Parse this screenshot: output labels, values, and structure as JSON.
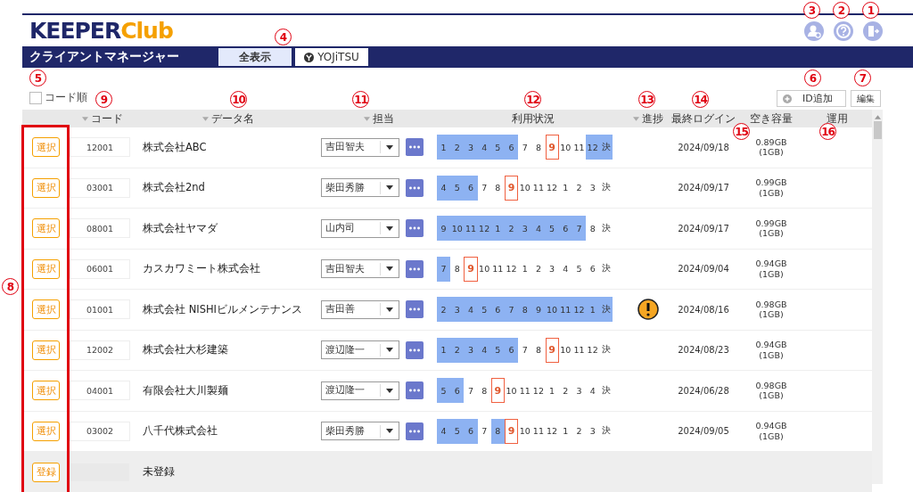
{
  "logo": {
    "brand": "KEEPER",
    "suffix": "Club"
  },
  "nav": {
    "title": "クライアントマネージャー",
    "tabs": [
      {
        "label": "全表示",
        "selected": true,
        "kind": "plain"
      },
      {
        "label": "YOJiTSU",
        "selected": false,
        "kind": "brand"
      }
    ]
  },
  "sort_option": {
    "label": "コード順",
    "checked": false
  },
  "toolbar": {
    "add_button": "ID追加",
    "edit_button": "編集"
  },
  "table": {
    "columns": [
      {
        "label": "コード",
        "sortable": true
      },
      {
        "label": "データ名",
        "sortable": true
      },
      {
        "label": "担当",
        "sortable": true
      },
      {
        "label": "利用状況",
        "sortable": false
      },
      {
        "label": "進捗",
        "sortable": true
      },
      {
        "label": "最終ログイン",
        "sortable": false
      },
      {
        "label": "空き容量",
        "sortable": false
      },
      {
        "label": "運用",
        "sortable": false
      }
    ],
    "rows": [
      {
        "kind": "client",
        "action": "選択",
        "code": "12001",
        "name": "株式会社ABC",
        "staff": "吉田智夫",
        "warning": false,
        "last_login": "2024/09/18",
        "capacity": "0.89GB",
        "quota": "(1GB)",
        "months": [
          {
            "m": "1",
            "used": true,
            "current": false
          },
          {
            "m": "2",
            "used": true,
            "current": false
          },
          {
            "m": "3",
            "used": true,
            "current": false
          },
          {
            "m": "4",
            "used": true,
            "current": false
          },
          {
            "m": "5",
            "used": true,
            "current": false
          },
          {
            "m": "6",
            "used": true,
            "current": false
          },
          {
            "m": "7",
            "used": false,
            "current": false
          },
          {
            "m": "8",
            "used": false,
            "current": false
          },
          {
            "m": "9",
            "used": false,
            "current": true
          },
          {
            "m": "10",
            "used": false,
            "current": false
          },
          {
            "m": "11",
            "used": false,
            "current": false
          },
          {
            "m": "12",
            "used": true,
            "current": false
          },
          {
            "m": "決",
            "used": true,
            "current": false
          }
        ]
      },
      {
        "kind": "client",
        "action": "選択",
        "code": "03001",
        "name": "株式会社2nd",
        "staff": "柴田秀勝",
        "warning": false,
        "last_login": "2024/09/17",
        "capacity": "0.99GB",
        "quota": "(1GB)",
        "months": [
          {
            "m": "4",
            "used": true,
            "current": false
          },
          {
            "m": "5",
            "used": true,
            "current": false
          },
          {
            "m": "6",
            "used": true,
            "current": false
          },
          {
            "m": "7",
            "used": false,
            "current": false
          },
          {
            "m": "8",
            "used": false,
            "current": false
          },
          {
            "m": "9",
            "used": false,
            "current": true
          },
          {
            "m": "10",
            "used": false,
            "current": false
          },
          {
            "m": "11",
            "used": false,
            "current": false
          },
          {
            "m": "12",
            "used": false,
            "current": false
          },
          {
            "m": "1",
            "used": false,
            "current": false
          },
          {
            "m": "2",
            "used": false,
            "current": false
          },
          {
            "m": "3",
            "used": false,
            "current": false
          },
          {
            "m": "決",
            "used": false,
            "current": false
          }
        ]
      },
      {
        "kind": "client",
        "action": "選択",
        "code": "08001",
        "name": "株式会社ヤマダ",
        "staff": "山内司",
        "warning": false,
        "last_login": "2024/09/17",
        "capacity": "0.99GB",
        "quota": "(1GB)",
        "months": [
          {
            "m": "9",
            "used": true,
            "current": false
          },
          {
            "m": "10",
            "used": true,
            "current": false
          },
          {
            "m": "11",
            "used": true,
            "current": false
          },
          {
            "m": "12",
            "used": true,
            "current": false
          },
          {
            "m": "1",
            "used": true,
            "current": false
          },
          {
            "m": "2",
            "used": true,
            "current": false
          },
          {
            "m": "3",
            "used": true,
            "current": false
          },
          {
            "m": "4",
            "used": true,
            "current": false
          },
          {
            "m": "5",
            "used": true,
            "current": false
          },
          {
            "m": "6",
            "used": true,
            "current": false
          },
          {
            "m": "7",
            "used": true,
            "current": false
          },
          {
            "m": "8",
            "used": false,
            "current": false
          },
          {
            "m": "決",
            "used": false,
            "current": false
          }
        ]
      },
      {
        "kind": "client",
        "action": "選択",
        "code": "06001",
        "name": "カスカワミート株式会社",
        "staff": "吉田智夫",
        "warning": false,
        "last_login": "2024/09/04",
        "capacity": "0.94GB",
        "quota": "(1GB)",
        "months": [
          {
            "m": "7",
            "used": true,
            "current": false
          },
          {
            "m": "8",
            "used": false,
            "current": false
          },
          {
            "m": "9",
            "used": false,
            "current": true
          },
          {
            "m": "10",
            "used": false,
            "current": false
          },
          {
            "m": "11",
            "used": false,
            "current": false
          },
          {
            "m": "12",
            "used": false,
            "current": false
          },
          {
            "m": "1",
            "used": false,
            "current": false
          },
          {
            "m": "2",
            "used": false,
            "current": false
          },
          {
            "m": "3",
            "used": false,
            "current": false
          },
          {
            "m": "4",
            "used": false,
            "current": false
          },
          {
            "m": "5",
            "used": false,
            "current": false
          },
          {
            "m": "6",
            "used": false,
            "current": false
          },
          {
            "m": "決",
            "used": false,
            "current": false
          }
        ]
      },
      {
        "kind": "client",
        "action": "選択",
        "code": "01001",
        "name": "株式会社 NISHIビルメンテナンス",
        "staff": "吉田善",
        "warning": true,
        "last_login": "2024/08/16",
        "capacity": "0.98GB",
        "quota": "(1GB)",
        "months": [
          {
            "m": "2",
            "used": true,
            "current": false
          },
          {
            "m": "3",
            "used": true,
            "current": false
          },
          {
            "m": "4",
            "used": true,
            "current": false
          },
          {
            "m": "5",
            "used": true,
            "current": false
          },
          {
            "m": "6",
            "used": true,
            "current": false
          },
          {
            "m": "7",
            "used": true,
            "current": false
          },
          {
            "m": "8",
            "used": true,
            "current": false
          },
          {
            "m": "9",
            "used": true,
            "current": false
          },
          {
            "m": "10",
            "used": true,
            "current": false
          },
          {
            "m": "11",
            "used": true,
            "current": false
          },
          {
            "m": "12",
            "used": true,
            "current": false
          },
          {
            "m": "1",
            "used": true,
            "current": false
          },
          {
            "m": "決",
            "used": true,
            "current": false
          }
        ]
      },
      {
        "kind": "client",
        "action": "選択",
        "code": "12002",
        "name": "株式会社大杉建築",
        "staff": "渡辺隆一",
        "warning": false,
        "last_login": "2024/08/23",
        "capacity": "0.94GB",
        "quota": "(1GB)",
        "months": [
          {
            "m": "1",
            "used": true,
            "current": false
          },
          {
            "m": "2",
            "used": true,
            "current": false
          },
          {
            "m": "3",
            "used": true,
            "current": false
          },
          {
            "m": "4",
            "used": true,
            "current": false
          },
          {
            "m": "5",
            "used": true,
            "current": false
          },
          {
            "m": "6",
            "used": true,
            "current": false
          },
          {
            "m": "7",
            "used": false,
            "current": false
          },
          {
            "m": "8",
            "used": false,
            "current": false
          },
          {
            "m": "9",
            "used": false,
            "current": true
          },
          {
            "m": "10",
            "used": false,
            "current": false
          },
          {
            "m": "11",
            "used": false,
            "current": false
          },
          {
            "m": "12",
            "used": false,
            "current": false
          },
          {
            "m": "決",
            "used": false,
            "current": false
          }
        ]
      },
      {
        "kind": "client",
        "action": "選択",
        "code": "04001",
        "name": "有限会社大川製麺",
        "staff": "渡辺隆一",
        "warning": false,
        "last_login": "2024/06/28",
        "capacity": "0.98GB",
        "quota": "(1GB)",
        "months": [
          {
            "m": "5",
            "used": true,
            "current": false
          },
          {
            "m": "6",
            "used": true,
            "current": false
          },
          {
            "m": "7",
            "used": false,
            "current": false
          },
          {
            "m": "8",
            "used": false,
            "current": false
          },
          {
            "m": "9",
            "used": false,
            "current": true
          },
          {
            "m": "10",
            "used": false,
            "current": false
          },
          {
            "m": "11",
            "used": false,
            "current": false
          },
          {
            "m": "12",
            "used": false,
            "current": false
          },
          {
            "m": "1",
            "used": false,
            "current": false
          },
          {
            "m": "2",
            "used": false,
            "current": false
          },
          {
            "m": "3",
            "used": false,
            "current": false
          },
          {
            "m": "4",
            "used": false,
            "current": false
          },
          {
            "m": "決",
            "used": false,
            "current": false
          }
        ]
      },
      {
        "kind": "client",
        "action": "選択",
        "code": "03002",
        "name": "八千代株式会社",
        "staff": "柴田秀勝",
        "warning": false,
        "last_login": "2024/09/05",
        "capacity": "0.94GB",
        "quota": "(1GB)",
        "months": [
          {
            "m": "4",
            "used": true,
            "current": false
          },
          {
            "m": "5",
            "used": true,
            "current": false
          },
          {
            "m": "6",
            "used": true,
            "current": false
          },
          {
            "m": "7",
            "used": false,
            "current": false
          },
          {
            "m": "8",
            "used": true,
            "current": false
          },
          {
            "m": "9",
            "used": false,
            "current": true
          },
          {
            "m": "10",
            "used": false,
            "current": false
          },
          {
            "m": "11",
            "used": false,
            "current": false
          },
          {
            "m": "12",
            "used": false,
            "current": false
          },
          {
            "m": "1",
            "used": false,
            "current": false
          },
          {
            "m": "2",
            "used": false,
            "current": false
          },
          {
            "m": "3",
            "used": false,
            "current": false
          },
          {
            "m": "決",
            "used": false,
            "current": false
          }
        ]
      },
      {
        "kind": "unregistered",
        "action": "登録",
        "name": "未登録"
      }
    ]
  },
  "callouts": [
    "3",
    "2",
    "1",
    "4",
    "5",
    "6",
    "7",
    "9",
    "10",
    "11",
    "12",
    "13",
    "14",
    "15",
    "16",
    "8"
  ]
}
